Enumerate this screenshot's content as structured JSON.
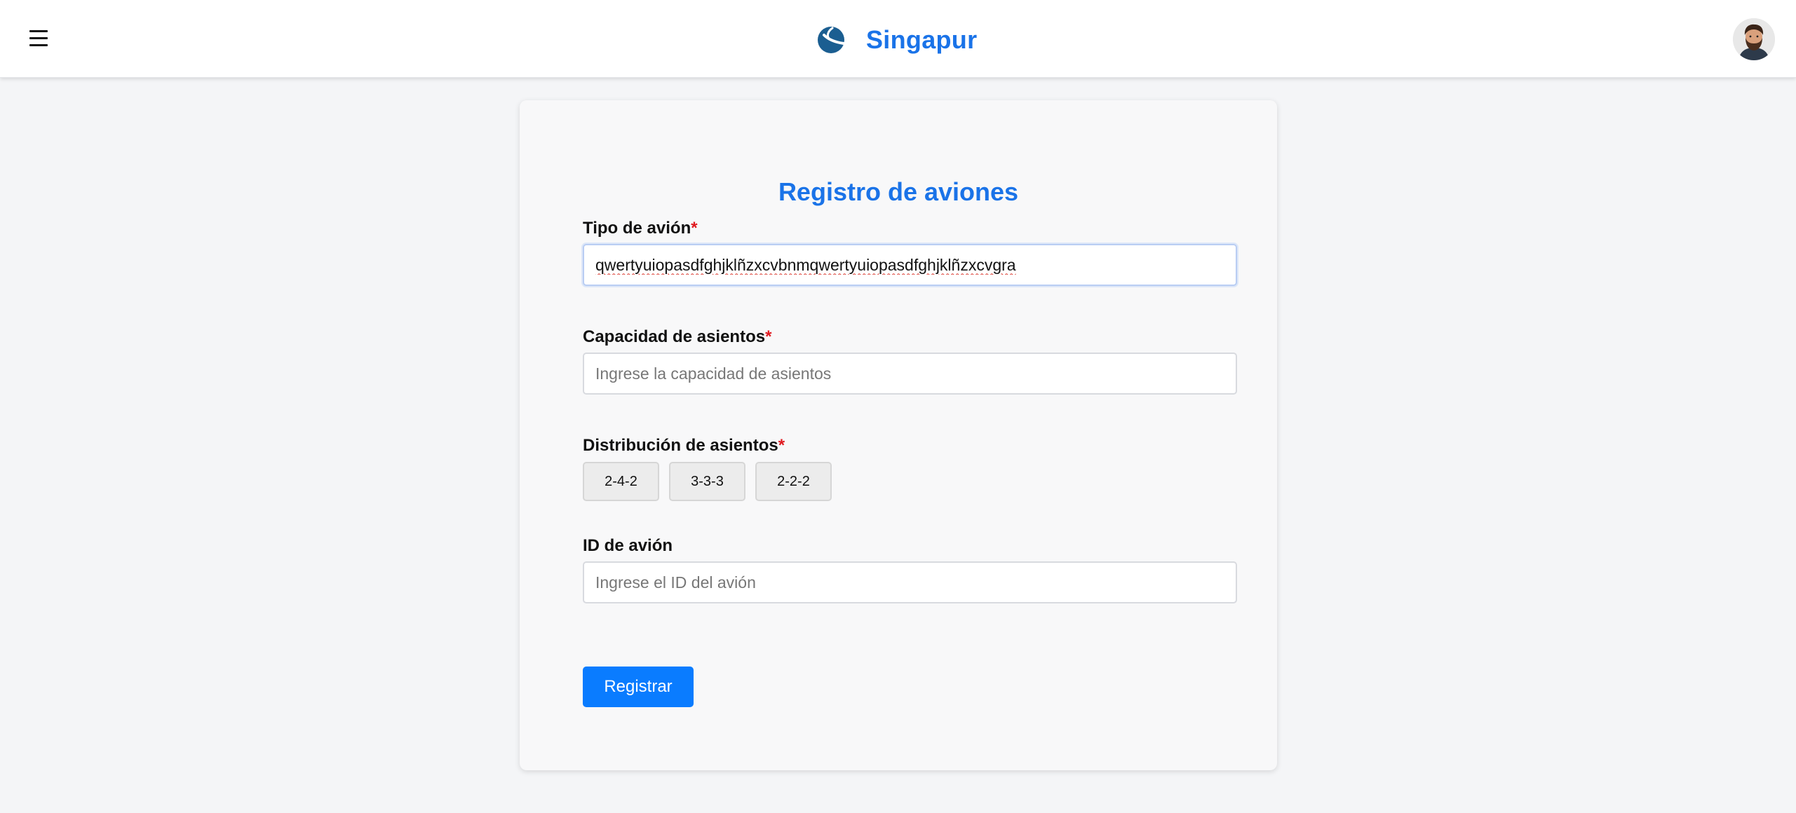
{
  "header": {
    "brand_name": "Singapur",
    "menu_icon": "hamburger-menu-icon",
    "logo_icon": "airline-logo-icon",
    "avatar_icon": "user-avatar",
    "accent_color": "#1a73e8"
  },
  "form": {
    "title": "Registro de aviones",
    "required_marker": "*",
    "aircraft_type": {
      "label": "Tipo de avión",
      "value": "qwertyuiopasdfghjklñzxcvbnmqwertyuiopasdfghjklñzxcvgra"
    },
    "seat_capacity": {
      "label": "Capacidad de asientos",
      "placeholder": "Ingrese la capacidad de asientos",
      "value": ""
    },
    "seat_distribution": {
      "label": "Distribución de asientos",
      "options": [
        "2-4-2",
        "3-3-3",
        "2-2-2"
      ]
    },
    "aircraft_id": {
      "label": "ID de avión",
      "placeholder": "Ingrese el ID del avión",
      "value": ""
    },
    "submit_label": "Registrar",
    "submit_color": "#0a7cff"
  }
}
